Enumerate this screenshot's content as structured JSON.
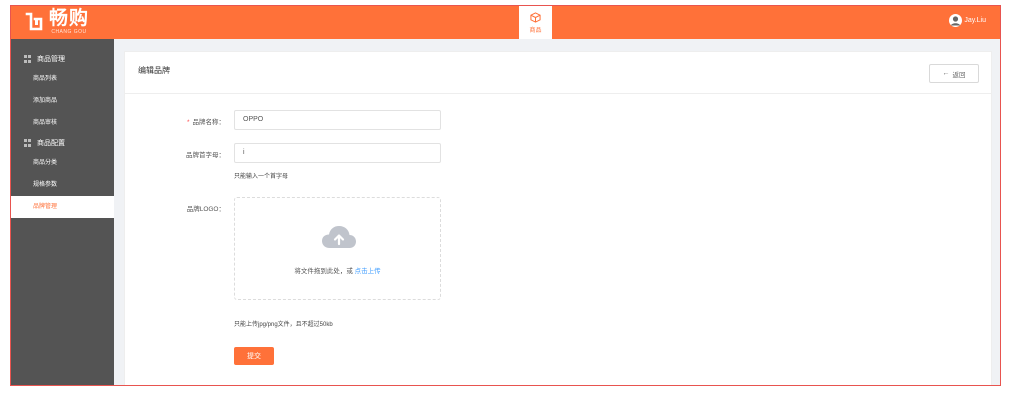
{
  "app": {
    "logo_cn": "畅购",
    "logo_en": "CHANG GOU"
  },
  "topnav": {
    "tab_label": "商品",
    "tab_icon": "cube-icon"
  },
  "user": {
    "name": "Jay.Liu"
  },
  "sidebar": {
    "groups": [
      {
        "label": "商品管理",
        "items": [
          {
            "label": "商品列表"
          },
          {
            "label": "添加商品"
          },
          {
            "label": "商品审核"
          }
        ]
      },
      {
        "label": "商品配置",
        "items": [
          {
            "label": "商品分类"
          },
          {
            "label": "规格参数"
          },
          {
            "label": "品牌管理",
            "active": true
          }
        ]
      }
    ]
  },
  "page": {
    "title": "编辑品牌",
    "back_label": "返回"
  },
  "form": {
    "name_label": "品牌名称：",
    "name_value": "OPPO",
    "letter_label": "品牌首字母：",
    "letter_value": "i",
    "letter_hint": "只能输入一个首字母",
    "logo_label": "品牌LOGO：",
    "upload_text": "将文件拖到此处，或",
    "upload_link": "点击上传",
    "upload_hint": "只能上传jpg/png文件，且不超过50kb",
    "submit_label": "提交"
  },
  "colors": {
    "brand": "#ff7139",
    "sidebar": "#545454",
    "link": "#409eff",
    "required": "#ff4d4f"
  }
}
